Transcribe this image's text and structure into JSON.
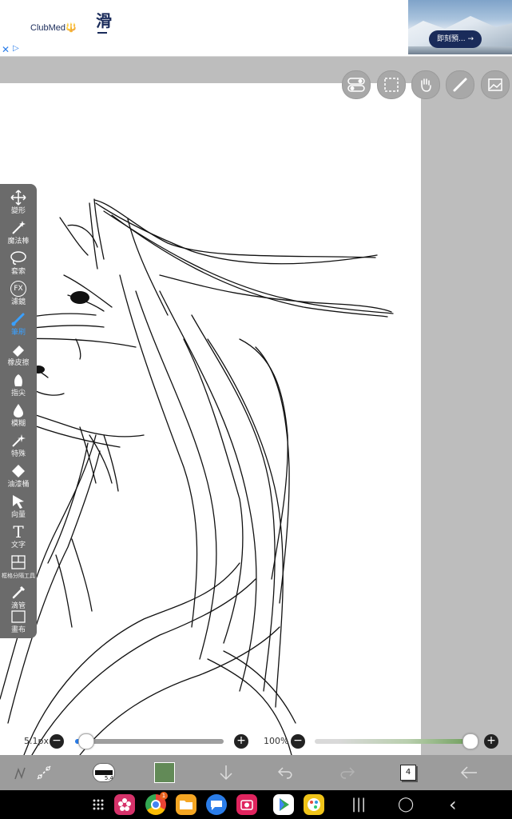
{
  "ad": {
    "brand": "ClubMed🔱",
    "headline": "滑",
    "cta": "即刻預... →",
    "close_glyph": "✕",
    "adchoices_glyph": "▷"
  },
  "toolbar": {
    "items": [
      {
        "label": "變形",
        "icon": "move-arrows-icon"
      },
      {
        "label": "魔法棒",
        "icon": "magic-wand-icon"
      },
      {
        "label": "套索",
        "icon": "lasso-icon"
      },
      {
        "label": "濾鏡",
        "icon": "fx-filter-icon"
      },
      {
        "label": "筆刷",
        "icon": "brush-icon"
      },
      {
        "label": "橡皮擦",
        "icon": "eraser-icon"
      },
      {
        "label": "指尖",
        "icon": "smudge-finger-icon"
      },
      {
        "label": "模糊",
        "icon": "blur-drop-icon"
      },
      {
        "label": "特殊",
        "icon": "special-sparkle-icon"
      },
      {
        "label": "油漆桶",
        "icon": "paint-bucket-icon"
      },
      {
        "label": "向量",
        "icon": "vector-arrow-icon"
      },
      {
        "label": "文字",
        "icon": "text-t-icon"
      },
      {
        "label": "框格分隔工具",
        "icon": "frame-divider-icon"
      },
      {
        "label": "滴管",
        "icon": "eyedropper-icon"
      },
      {
        "label": "畫布",
        "icon": "canvas-icon"
      }
    ],
    "active_index": 4,
    "fx_text": "FX",
    "t_text": "T"
  },
  "sliders": {
    "brush_size": "5.1px",
    "brush_size_fraction": 0.05,
    "opacity": "100%",
    "opacity_fraction": 1.0,
    "minus": "−",
    "plus": "+"
  },
  "bottom": {
    "brush_preview_num": "5.4",
    "color": "#628a57",
    "layer_count": "4"
  },
  "nav": {
    "badge": "1",
    "recents": "|||",
    "home": "◯",
    "back": "‹"
  }
}
